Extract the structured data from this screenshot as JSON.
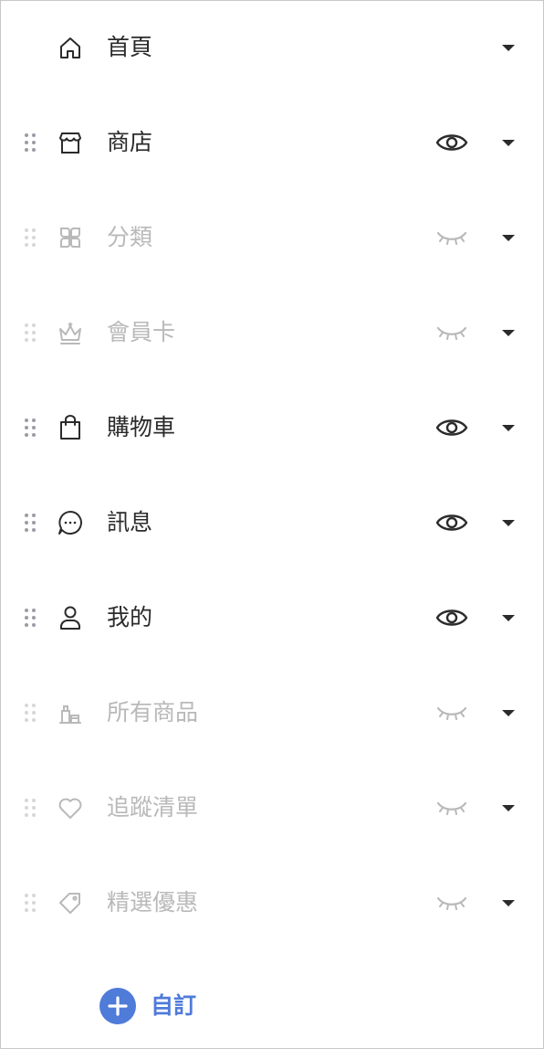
{
  "nav_items": [
    {
      "label": "首頁",
      "icon": "home-icon",
      "visible": true,
      "draggable": false,
      "visibility_toggle": false
    },
    {
      "label": "商店",
      "icon": "store-icon",
      "visible": true,
      "draggable": true,
      "visibility_toggle": true
    },
    {
      "label": "分類",
      "icon": "category-icon",
      "visible": false,
      "draggable": true,
      "visibility_toggle": true
    },
    {
      "label": "會員卡",
      "icon": "crown-icon",
      "visible": false,
      "draggable": true,
      "visibility_toggle": true
    },
    {
      "label": "購物車",
      "icon": "shopping-bag-icon",
      "visible": true,
      "draggable": true,
      "visibility_toggle": true
    },
    {
      "label": "訊息",
      "icon": "chat-bubble-icon",
      "visible": true,
      "draggable": true,
      "visibility_toggle": true
    },
    {
      "label": "我的",
      "icon": "user-icon",
      "visible": true,
      "draggable": true,
      "visibility_toggle": true
    },
    {
      "label": "所有商品",
      "icon": "products-icon",
      "visible": false,
      "draggable": true,
      "visibility_toggle": true
    },
    {
      "label": "追蹤清單",
      "icon": "heart-icon",
      "visible": false,
      "draggable": true,
      "visibility_toggle": true
    },
    {
      "label": "精選優惠",
      "icon": "tag-icon",
      "visible": false,
      "draggable": true,
      "visibility_toggle": true
    }
  ],
  "custom_button": {
    "label": "自訂",
    "icon": "plus-icon"
  },
  "colors": {
    "text_active": "#2b2b2b",
    "text_hidden": "#b9b9b9",
    "accent": "#4f7bd9",
    "border": "#c8c8c8"
  }
}
